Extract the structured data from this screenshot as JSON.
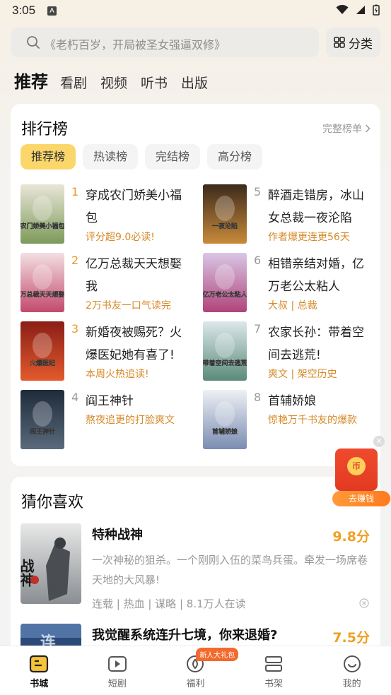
{
  "status": {
    "time": "3:05",
    "notification_letter": "A"
  },
  "search": {
    "placeholder": "《老朽百岁，开局被圣女强逼双修》"
  },
  "category_label": "分类",
  "nav_tabs": [
    "推荐",
    "看剧",
    "视频",
    "听书",
    "出版"
  ],
  "ranking": {
    "title": "排行榜",
    "full_list_label": "完整榜单",
    "chips": [
      "推荐榜",
      "热读榜",
      "完结榜",
      "高分榜"
    ],
    "items": [
      {
        "rank": "1",
        "title": "穿成农门娇美小福包",
        "sub": "评分超9.0必读!",
        "rank_color": "#e89b2a",
        "cover_text": "农门娇美小福包",
        "cover_colors": [
          "#e9e6d8",
          "#7d9a5a"
        ]
      },
      {
        "rank": "2",
        "title": "亿万总裁天天想娶我",
        "sub": "2万书友一口气读完",
        "rank_color": "#e89b2a",
        "cover_text": "亿万总裁天天想娶我",
        "cover_colors": [
          "#f3dfe3",
          "#c24a6c"
        ]
      },
      {
        "rank": "3",
        "title": "新婚夜被赐死？火爆医妃她有喜了!",
        "sub": "本周火热追读!",
        "rank_color": "#e89b2a",
        "cover_text": "火爆医妃",
        "cover_colors": [
          "#8a1e16",
          "#e35a2c"
        ]
      },
      {
        "rank": "4",
        "title": "阎王神针",
        "sub": "熬夜追更的打脸爽文",
        "rank_color": "#9a9a9a",
        "cover_text": "阎王神针",
        "cover_colors": [
          "#1e2b3a",
          "#5a6a7c"
        ]
      },
      {
        "rank": "5",
        "title": "醉酒走错房，冰山女总裁一夜沦陷",
        "sub": "作者爆更连更56天",
        "rank_color": "#9a9a9a",
        "cover_text": "一夜沦陷",
        "cover_colors": [
          "#3c2a1c",
          "#c98a3a"
        ]
      },
      {
        "rank": "6",
        "title": "相错亲结对婚，亿万老公太粘人",
        "sub": "大叔 | 总裁",
        "rank_color": "#9a9a9a",
        "cover_text": "亿万老公太粘人",
        "cover_colors": [
          "#d9c6e6",
          "#b0447a"
        ]
      },
      {
        "rank": "7",
        "title": "农家长孙：带着空间去逃荒!",
        "sub": "爽文 | 架空历史",
        "rank_color": "#9a9a9a",
        "cover_text": "带着空间去逃荒",
        "cover_colors": [
          "#dce8ea",
          "#5a8a7a"
        ]
      },
      {
        "rank": "8",
        "title": "首辅娇娘",
        "sub": "惊艳万千书友的爆款",
        "rank_color": "#9a9a9a",
        "cover_text": "首辅娇娘",
        "cover_colors": [
          "#eef0f4",
          "#7a8cb2"
        ]
      }
    ]
  },
  "guess": {
    "title": "猜你喜欢",
    "books": [
      {
        "title": "特种战神",
        "score": "9.8分",
        "desc": "一次神秘的狙杀。一个刚刚入伍的菜鸟兵蛋。牵发一场席卷天地的大风暴!",
        "tags": "连载 | 热血 | 谋略 | 8.1万人在读",
        "cover_text": "战神"
      },
      {
        "title": "我觉醒系统连升七境，你来退婚?",
        "score": "7.5分"
      }
    ]
  },
  "red_packet": {
    "label": "去赚钱",
    "coin": "币"
  },
  "bottom_nav": [
    {
      "label": "书城",
      "icon": "bookstore-icon",
      "active": true
    },
    {
      "label": "短剧",
      "icon": "play-icon",
      "active": false
    },
    {
      "label": "福利",
      "icon": "welfare-icon",
      "active": false,
      "badge": "新人大礼包"
    },
    {
      "label": "书架",
      "icon": "bookshelf-icon",
      "active": false
    },
    {
      "label": "我的",
      "icon": "profile-icon",
      "active": false
    }
  ]
}
